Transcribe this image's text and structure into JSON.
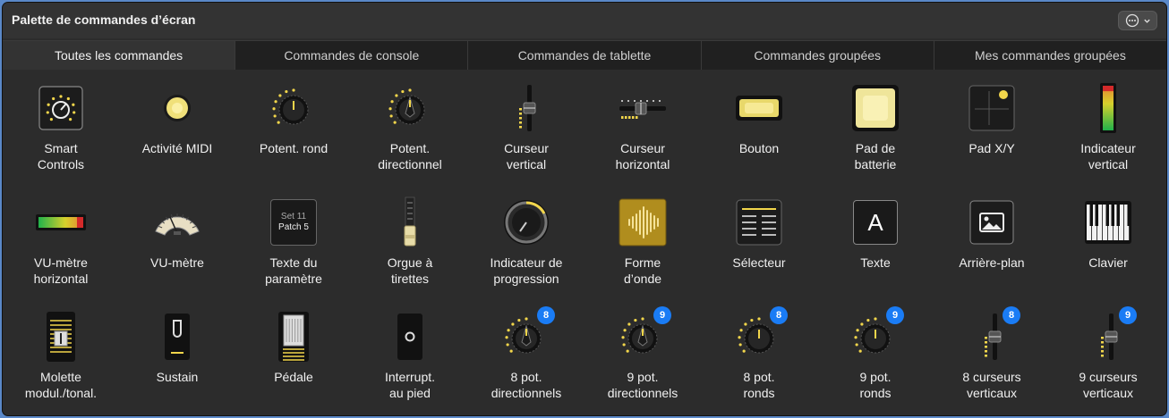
{
  "window": {
    "title": "Palette de commandes d’écran"
  },
  "tabs": [
    {
      "label": "Toutes les commandes",
      "active": true
    },
    {
      "label": "Commandes de console",
      "active": false
    },
    {
      "label": "Commandes de tablette",
      "active": false
    },
    {
      "label": "Commandes groupées",
      "active": false
    },
    {
      "label": "Mes commandes groupées",
      "active": false
    }
  ],
  "controls": [
    {
      "label": "Smart\nControls",
      "icon": "smart-controls-icon"
    },
    {
      "label": "Activité MIDI",
      "icon": "midi-activity-icon"
    },
    {
      "label": "Potent. rond",
      "icon": "round-knob-icon"
    },
    {
      "label": "Potent.\ndirectionnel",
      "icon": "directional-knob-icon"
    },
    {
      "label": "Curseur\nvertical",
      "icon": "vertical-slider-icon"
    },
    {
      "label": "Curseur\nhorizontal",
      "icon": "horizontal-slider-icon"
    },
    {
      "label": "Bouton",
      "icon": "button-icon"
    },
    {
      "label": "Pad de\nbatterie",
      "icon": "drum-pad-icon"
    },
    {
      "label": "Pad X/Y",
      "icon": "xy-pad-icon"
    },
    {
      "label": "Indicateur\nvertical",
      "icon": "vertical-meter-icon"
    },
    {
      "label": "VU-mètre\nhorizontal",
      "icon": "horizontal-vu-meter-icon"
    },
    {
      "label": "VU-mètre",
      "icon": "vu-meter-icon"
    },
    {
      "label": "Texte du\nparamètre",
      "icon": "parameter-text-icon",
      "line1": "Set 11",
      "line2": "Patch 5"
    },
    {
      "label": "Orgue à\ntirettes",
      "icon": "drawbar-icon"
    },
    {
      "label": "Indicateur de\nprogression",
      "icon": "progress-indicator-icon"
    },
    {
      "label": "Forme\nd’onde",
      "icon": "waveform-icon"
    },
    {
      "label": "Sélecteur",
      "icon": "picker-icon"
    },
    {
      "label": "Texte",
      "icon": "text-icon",
      "glyph": "A"
    },
    {
      "label": "Arrière-plan",
      "icon": "background-image-icon"
    },
    {
      "label": "Clavier",
      "icon": "keyboard-icon"
    },
    {
      "label": "Molette\nmodul./tonal.",
      "icon": "mod-pitch-wheel-icon"
    },
    {
      "label": "Sustain",
      "icon": "sustain-icon"
    },
    {
      "label": "Pédale",
      "icon": "pedal-icon"
    },
    {
      "label": "Interrupt.\nau pied",
      "icon": "footswitch-icon"
    },
    {
      "label": "8 pot.\ndirectionnels",
      "icon": "directional-knob-icon",
      "badge": "8"
    },
    {
      "label": "9 pot.\ndirectionnels",
      "icon": "directional-knob-icon",
      "badge": "9"
    },
    {
      "label": "8 pot.\nronds",
      "icon": "round-knob-icon",
      "badge": "8"
    },
    {
      "label": "9 pot.\nronds",
      "icon": "round-knob-icon",
      "badge": "9"
    },
    {
      "label": "8 curseurs\nverticaux",
      "icon": "vertical-slider-icon",
      "badge": "8"
    },
    {
      "label": "9 curseurs\nverticaux",
      "icon": "vertical-slider-icon",
      "badge": "9"
    }
  ],
  "colors": {
    "accent_yellow": "#f2d64b",
    "badge_blue": "#1a7cf5",
    "background": "#2c2c2c"
  }
}
